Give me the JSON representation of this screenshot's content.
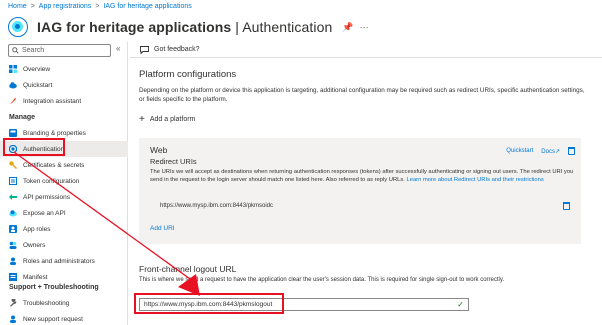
{
  "breadcrumb": [
    "Home",
    "App registrations",
    "IAG for heritage applications"
  ],
  "title": {
    "bold": "IAG for heritage applications",
    "sep": " | ",
    "light": "Authentication"
  },
  "sidebar": {
    "search_placeholder": "Search",
    "items_top": [
      {
        "label": "Overview",
        "icon": "grid-icon",
        "color": "#0078d4"
      },
      {
        "label": "Quickstart",
        "icon": "cloud-icon",
        "color": "#0078d4"
      },
      {
        "label": "Integration assistant",
        "icon": "rocket-icon",
        "color": "#d83b01"
      }
    ],
    "manage_header": "Manage",
    "items_manage": [
      {
        "label": "Branding & properties",
        "icon": "palette-icon",
        "color": "#0078d4"
      },
      {
        "label": "Authentication",
        "icon": "auth-icon",
        "color": "#0078d4"
      },
      {
        "label": "Certificates & secrets",
        "icon": "key-icon",
        "color": "#e8a317"
      },
      {
        "label": "Token configuration",
        "icon": "token-icon",
        "color": "#0078d4"
      },
      {
        "label": "API permissions",
        "icon": "permissions-icon",
        "color": "#00b294"
      },
      {
        "label": "Expose an API",
        "icon": "cloud-api-icon",
        "color": "#0078d4"
      },
      {
        "label": "App roles",
        "icon": "roles-icon",
        "color": "#0078d4"
      },
      {
        "label": "Owners",
        "icon": "owners-icon",
        "color": "#0078d4"
      },
      {
        "label": "Roles and administrators",
        "icon": "admin-icon",
        "color": "#0078d4"
      },
      {
        "label": "Manifest",
        "icon": "manifest-icon",
        "color": "#0078d4"
      }
    ],
    "support_header": "Support + Troubleshooting",
    "items_support": [
      {
        "label": "Troubleshooting",
        "icon": "wrench-icon",
        "color": "#605e5c"
      },
      {
        "label": "New support request",
        "icon": "person-icon",
        "color": "#0078d4"
      }
    ]
  },
  "cmdbar": {
    "feedback": "Got feedback?"
  },
  "platform": {
    "title": "Platform configurations",
    "desc": "Depending on the platform or device this application is targeting, additional configuration may be required such as redirect URIs, specific authentication settings, or fields specific to the platform.",
    "add_label": "Add a platform"
  },
  "web": {
    "title": "Web",
    "subtitle": "Redirect URIs",
    "quickstart": "Quickstart",
    "docs": "Docs",
    "desc": "The URIs we will accept as destinations when returning authentication responses (tokens) after successfully authenticating or signing out users. The redirect URI you send in the request to the login server should match one listed here. Also referred to as reply URLs.",
    "desc_link": "Learn more about Redirect URIs and their restrictions",
    "uri": "https://www.mysp.ibm.com:8443/pkmsoidc",
    "add_uri": "Add URI"
  },
  "frontchannel": {
    "title": "Front-channel logout URL",
    "desc": "This is where we send a request to have the application clear the user's session data. This is required for single sign-out to work correctly.",
    "value": "https://www.mysp.ibm.com:8443/pkmslogout"
  },
  "annotation_color": "#e81123"
}
